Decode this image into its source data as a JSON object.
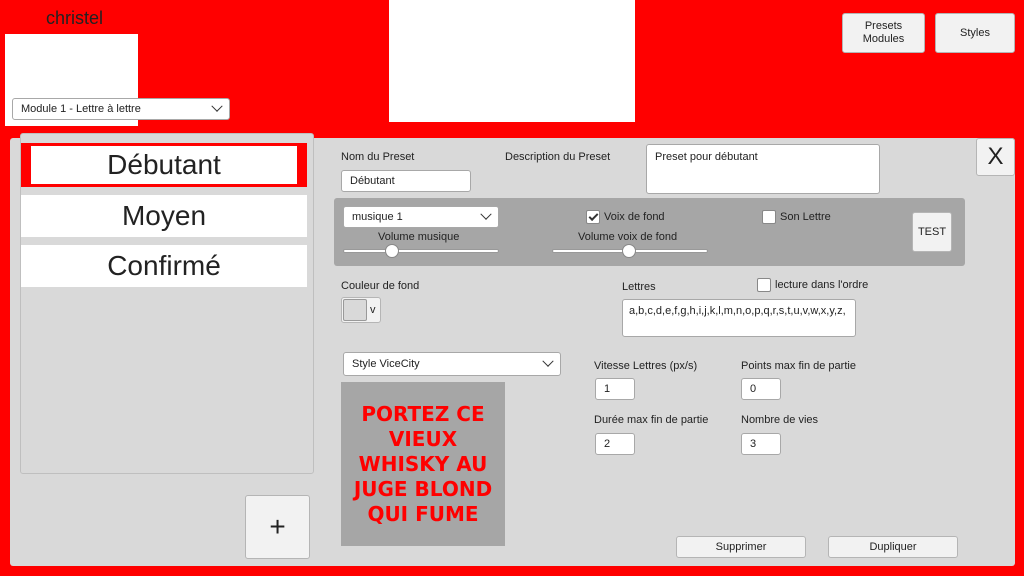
{
  "header": {
    "user_name": "christel",
    "module_select": "Module 1 - Lettre à lettre",
    "presets_modules_button": "Presets\nModules",
    "styles_button": "Styles"
  },
  "preset_list": {
    "items": [
      {
        "label": "Débutant",
        "selected": true
      },
      {
        "label": "Moyen",
        "selected": false
      },
      {
        "label": "Confirmé",
        "selected": false
      }
    ],
    "add_button": "+"
  },
  "form": {
    "close_button": "X",
    "preset_name_label": "Nom du Preset",
    "preset_name_value": "Débutant",
    "description_label": "Description du Preset",
    "description_value": "Preset pour débutant",
    "music_select": "musique 1",
    "music_volume_label": "Volume musique",
    "music_volume": 0.3,
    "voice_checkbox_label": "Voix de fond",
    "voice_checked": true,
    "voice_volume_label": "Volume voix de fond",
    "voice_volume": 0.45,
    "letter_sound_label": "Son Lettre",
    "letter_sound_checked": false,
    "test_button": "TEST",
    "bg_color_label": "Couleur de fond",
    "bg_color_dropdown": "v",
    "letters_label": "Lettres",
    "letters_value": "a,b,c,d,e,f,g,h,i,j,k,l,m,n,o,p,q,r,s,t,u,v,w,x,y,z,",
    "order_checkbox_label": "lecture dans l'ordre",
    "order_checked": false,
    "style_select": "Style ViceCity",
    "preview_text": "PORTEZ CE VIEUX WHISKY AU JUGE BLOND QUI FUME",
    "speed_label": "Vitesse Lettres (px/s)",
    "speed_value": "1",
    "max_points_label": "Points max fin de partie",
    "max_points_value": "0",
    "max_duration_label": "Durée max fin de partie",
    "max_duration_value": "2",
    "lives_label": "Nombre de vies",
    "lives_value": "3",
    "delete_button": "Supprimer",
    "duplicate_button": "Dupliquer"
  },
  "colors": {
    "background": "#ff0000",
    "panel": "#d9d9d9",
    "preview_bg": "#a6a6a6",
    "preview_text": "#ff0000"
  }
}
